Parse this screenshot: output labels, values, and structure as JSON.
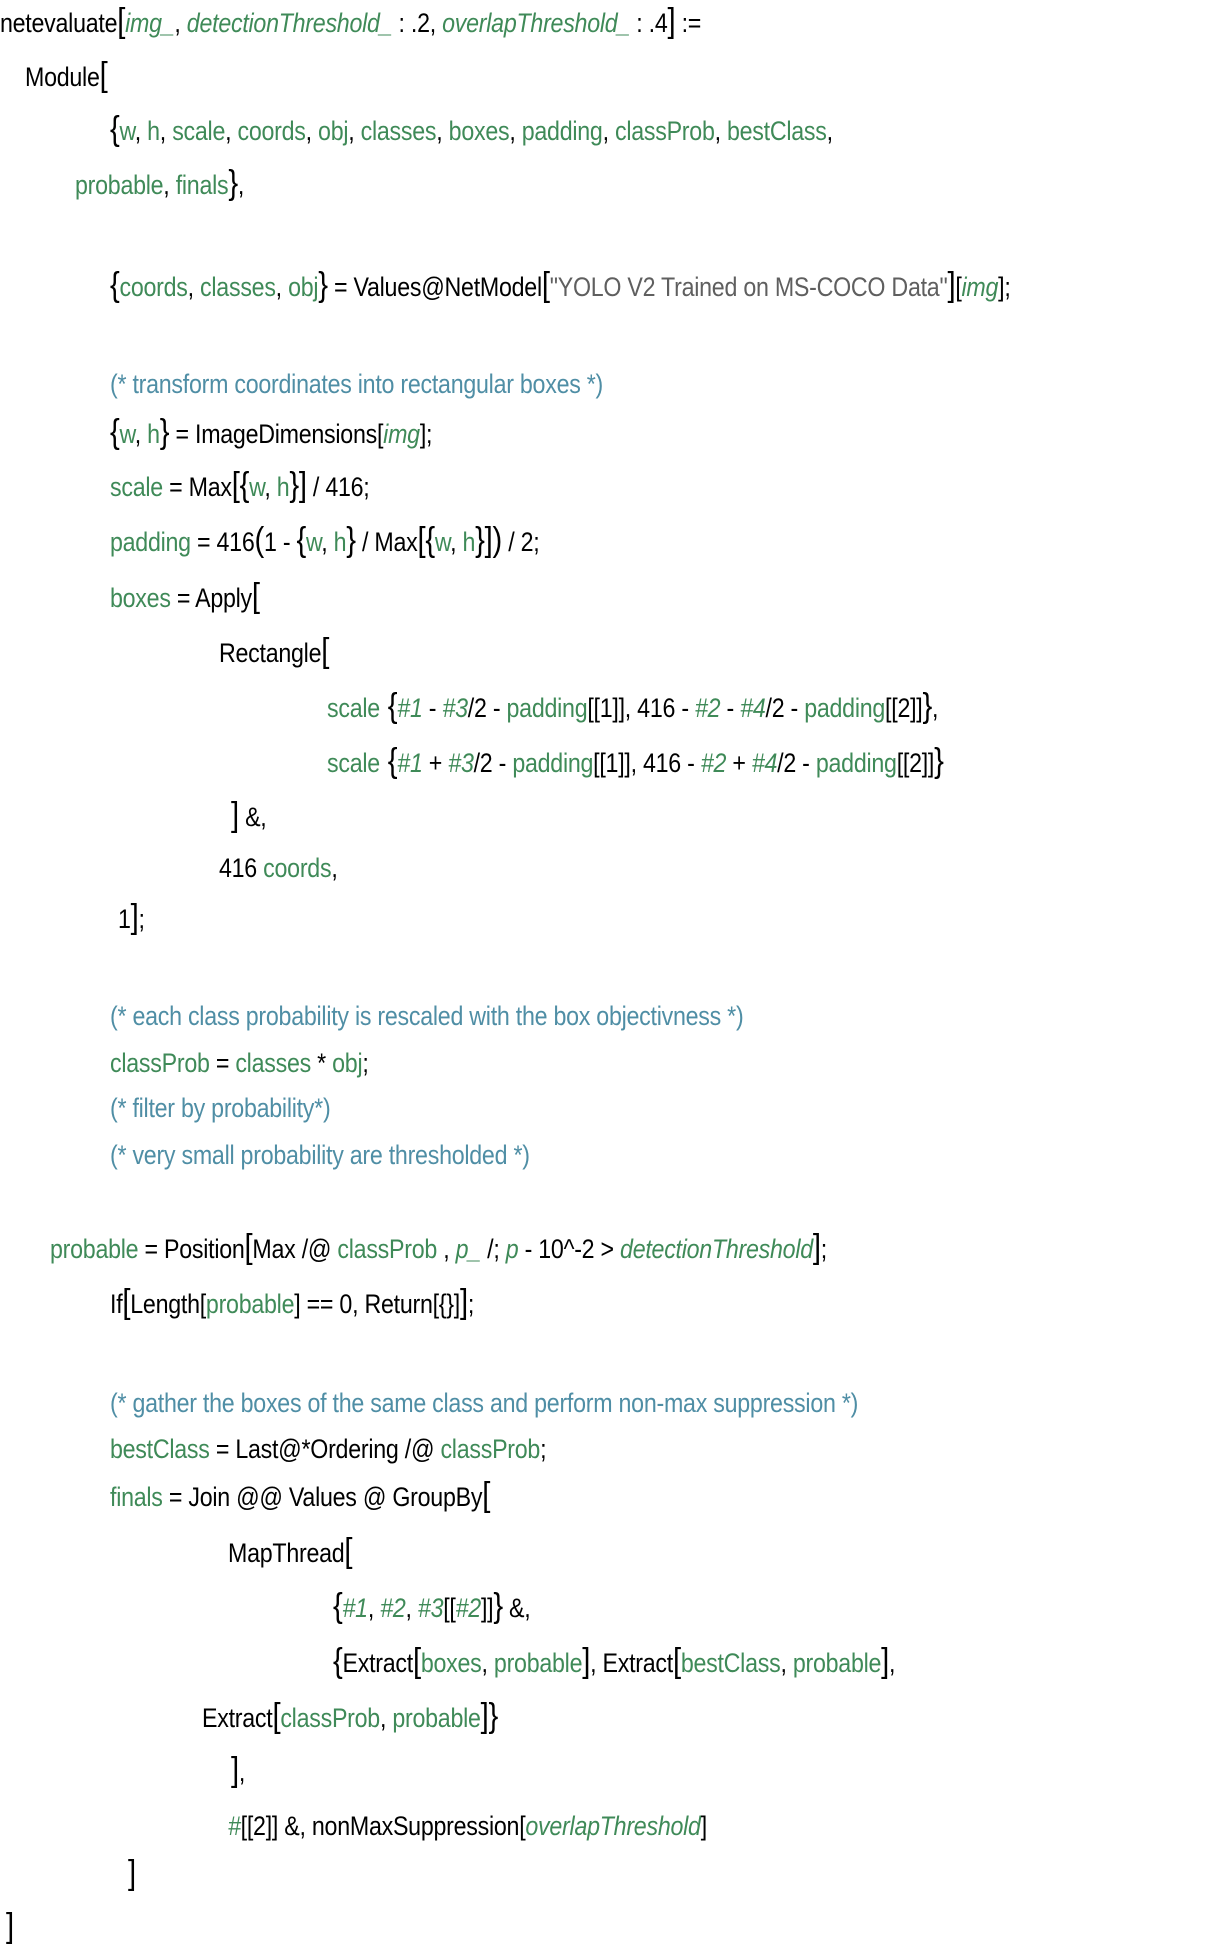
{
  "notebook": {
    "language": "Wolfram Language",
    "colors": {
      "keyword": "#000000",
      "local_variable": "#3f8a58",
      "string": "#5f5f5f",
      "comment": "#4f8ea5",
      "background": "#ffffff"
    },
    "lines": [
      {
        "tokens": [
          {
            "t": "netevaluate",
            "k": "k"
          },
          {
            "t": "[",
            "k": "k big"
          },
          {
            "t": "img_",
            "k": "vi"
          },
          {
            "t": ", ",
            "k": "k"
          },
          {
            "t": "detectionThreshold_",
            "k": "vi"
          },
          {
            "t": " : .2, ",
            "k": "k"
          },
          {
            "t": "overlapThreshold_",
            "k": "vi"
          },
          {
            "t": " : .4",
            "k": "k"
          },
          {
            "t": "]",
            "k": "k big"
          },
          {
            "t": " :=",
            "k": "k"
          }
        ]
      },
      {
        "tokens": [
          {
            "t": "Module",
            "k": "k"
          },
          {
            "t": "[",
            "k": "k big"
          }
        ]
      },
      {
        "tokens": [
          {
            "t": "{",
            "k": "k big"
          },
          {
            "t": "w",
            "k": "v"
          },
          {
            "t": ", ",
            "k": "k"
          },
          {
            "t": "h",
            "k": "v"
          },
          {
            "t": ", ",
            "k": "k"
          },
          {
            "t": "scale",
            "k": "v"
          },
          {
            "t": ", ",
            "k": "k"
          },
          {
            "t": "coords",
            "k": "v"
          },
          {
            "t": ", ",
            "k": "k"
          },
          {
            "t": "obj",
            "k": "v"
          },
          {
            "t": ", ",
            "k": "k"
          },
          {
            "t": "classes",
            "k": "v"
          },
          {
            "t": ", ",
            "k": "k"
          },
          {
            "t": "boxes",
            "k": "v"
          },
          {
            "t": ", ",
            "k": "k"
          },
          {
            "t": "padding",
            "k": "v"
          },
          {
            "t": ", ",
            "k": "k"
          },
          {
            "t": "classProb",
            "k": "v"
          },
          {
            "t": ", ",
            "k": "k"
          },
          {
            "t": "bestClass",
            "k": "v"
          },
          {
            "t": ",",
            "k": "k"
          }
        ]
      },
      {
        "tokens": [
          {
            "t": "probable",
            "k": "v"
          },
          {
            "t": ", ",
            "k": "k"
          },
          {
            "t": "finals",
            "k": "v"
          },
          {
            "t": "}",
            "k": "k big"
          },
          {
            "t": ",",
            "k": "k"
          }
        ]
      },
      {
        "tokens": [
          {
            "t": "{",
            "k": "k big"
          },
          {
            "t": "coords",
            "k": "v"
          },
          {
            "t": ", ",
            "k": "k"
          },
          {
            "t": "classes",
            "k": "v"
          },
          {
            "t": ", ",
            "k": "k"
          },
          {
            "t": "obj",
            "k": "v"
          },
          {
            "t": "}",
            "k": "k big"
          },
          {
            "t": " = Values@NetModel",
            "k": "k"
          },
          {
            "t": "[",
            "k": "k big"
          },
          {
            "t": "\"YOLO V2 Trained on MS-COCO Data\"",
            "k": "s"
          },
          {
            "t": "]",
            "k": "k big"
          },
          {
            "t": "[",
            "k": "k"
          },
          {
            "t": "img",
            "k": "vi"
          },
          {
            "t": "];",
            "k": "k"
          }
        ]
      },
      {
        "tokens": [
          {
            "t": "(* transform coordinates into rectangular boxes *)",
            "k": "c"
          }
        ]
      },
      {
        "tokens": [
          {
            "t": "{",
            "k": "k big"
          },
          {
            "t": "w",
            "k": "v"
          },
          {
            "t": ", ",
            "k": "k"
          },
          {
            "t": "h",
            "k": "v"
          },
          {
            "t": "}",
            "k": "k big"
          },
          {
            "t": " = ImageDimensions[",
            "k": "k"
          },
          {
            "t": "img",
            "k": "vi"
          },
          {
            "t": "];",
            "k": "k"
          }
        ]
      },
      {
        "tokens": [
          {
            "t": "scale",
            "k": "v"
          },
          {
            "t": " = Max",
            "k": "k"
          },
          {
            "t": "[{",
            "k": "k big"
          },
          {
            "t": "w",
            "k": "v"
          },
          {
            "t": ", ",
            "k": "k"
          },
          {
            "t": "h",
            "k": "v"
          },
          {
            "t": "}]",
            "k": "k big"
          },
          {
            "t": " / 416;",
            "k": "k"
          }
        ]
      },
      {
        "tokens": [
          {
            "t": "padding",
            "k": "v"
          },
          {
            "t": " = 416",
            "k": "k"
          },
          {
            "t": "(",
            "k": "k big"
          },
          {
            "t": "1 - ",
            "k": "k"
          },
          {
            "t": "{",
            "k": "k big"
          },
          {
            "t": "w",
            "k": "v"
          },
          {
            "t": ", ",
            "k": "k"
          },
          {
            "t": "h",
            "k": "v"
          },
          {
            "t": "}",
            "k": "k big"
          },
          {
            "t": " / Max",
            "k": "k"
          },
          {
            "t": "[{",
            "k": "k big"
          },
          {
            "t": "w",
            "k": "v"
          },
          {
            "t": ", ",
            "k": "k"
          },
          {
            "t": "h",
            "k": "v"
          },
          {
            "t": "}])",
            "k": "k big"
          },
          {
            "t": " / 2;",
            "k": "k"
          }
        ]
      },
      {
        "tokens": [
          {
            "t": "boxes",
            "k": "v"
          },
          {
            "t": " = Apply",
            "k": "k"
          },
          {
            "t": "[",
            "k": "k big"
          }
        ]
      },
      {
        "tokens": [
          {
            "t": "Rectangle",
            "k": "k"
          },
          {
            "t": "[",
            "k": "k big"
          }
        ]
      },
      {
        "tokens": [
          {
            "t": "scale",
            "k": "v"
          },
          {
            "t": " {",
            "k": "k big"
          },
          {
            "t": "#1",
            "k": "vi"
          },
          {
            "t": " - ",
            "k": "k"
          },
          {
            "t": "#3",
            "k": "vi"
          },
          {
            "t": "/2 - ",
            "k": "k"
          },
          {
            "t": "padding",
            "k": "v"
          },
          {
            "t": "[[1]], 416 - ",
            "k": "k"
          },
          {
            "t": "#2",
            "k": "vi"
          },
          {
            "t": " - ",
            "k": "k"
          },
          {
            "t": "#4",
            "k": "vi"
          },
          {
            "t": "/2 - ",
            "k": "k"
          },
          {
            "t": "padding",
            "k": "v"
          },
          {
            "t": "[[2]]",
            "k": "k"
          },
          {
            "t": "}",
            "k": "k big"
          },
          {
            "t": ",",
            "k": "k"
          }
        ]
      },
      {
        "tokens": [
          {
            "t": "scale",
            "k": "v"
          },
          {
            "t": " {",
            "k": "k big"
          },
          {
            "t": "#1",
            "k": "vi"
          },
          {
            "t": " + ",
            "k": "k"
          },
          {
            "t": "#3",
            "k": "vi"
          },
          {
            "t": "/2 - ",
            "k": "k"
          },
          {
            "t": "padding",
            "k": "v"
          },
          {
            "t": "[[1]], 416 - ",
            "k": "k"
          },
          {
            "t": "#2",
            "k": "vi"
          },
          {
            "t": " + ",
            "k": "k"
          },
          {
            "t": "#4",
            "k": "vi"
          },
          {
            "t": "/2 - ",
            "k": "k"
          },
          {
            "t": "padding",
            "k": "v"
          },
          {
            "t": "[[2]]",
            "k": "k"
          },
          {
            "t": "}",
            "k": "k big"
          }
        ]
      },
      {
        "tokens": [
          {
            "t": "]",
            "k": "k big"
          },
          {
            "t": " &,",
            "k": "k"
          }
        ]
      },
      {
        "tokens": [
          {
            "t": "416 ",
            "k": "k"
          },
          {
            "t": "coords",
            "k": "v"
          },
          {
            "t": ",",
            "k": "k"
          }
        ]
      },
      {
        "tokens": [
          {
            "t": "1",
            "k": "k"
          },
          {
            "t": "]",
            "k": "k big"
          },
          {
            "t": ";",
            "k": "k"
          }
        ]
      },
      {
        "tokens": [
          {
            "t": "(* each class probability is rescaled with the box objectivness *)",
            "k": "c"
          }
        ]
      },
      {
        "tokens": [
          {
            "t": "classProb",
            "k": "v"
          },
          {
            "t": " = ",
            "k": "k"
          },
          {
            "t": "classes",
            "k": "v"
          },
          {
            "t": " * ",
            "k": "k"
          },
          {
            "t": "obj",
            "k": "v"
          },
          {
            "t": ";",
            "k": "k"
          }
        ]
      },
      {
        "tokens": [
          {
            "t": "(* filter by probability*)",
            "k": "c"
          }
        ]
      },
      {
        "tokens": [
          {
            "t": "(* very small probability are thresholded *)",
            "k": "c"
          }
        ]
      },
      {
        "tokens": [
          {
            "t": "probable",
            "k": "v"
          },
          {
            "t": " = Position",
            "k": "k"
          },
          {
            "t": "[",
            "k": "k big"
          },
          {
            "t": "Max /@ ",
            "k": "k"
          },
          {
            "t": "classProb",
            "k": "v"
          },
          {
            "t": " , ",
            "k": "k"
          },
          {
            "t": "p_",
            "k": "vi"
          },
          {
            "t": " /; ",
            "k": "k"
          },
          {
            "t": "p",
            "k": "vi"
          },
          {
            "t": " - 10^-2 > ",
            "k": "k"
          },
          {
            "t": "detectionThreshold",
            "k": "vi"
          },
          {
            "t": "]",
            "k": "k big"
          },
          {
            "t": ";",
            "k": "k"
          }
        ]
      },
      {
        "tokens": [
          {
            "t": "If",
            "k": "k"
          },
          {
            "t": "[",
            "k": "k big"
          },
          {
            "t": "Length[",
            "k": "k"
          },
          {
            "t": "probable",
            "k": "v"
          },
          {
            "t": "] == 0, Return[{}]",
            "k": "k"
          },
          {
            "t": "]",
            "k": "k big"
          },
          {
            "t": ";",
            "k": "k"
          }
        ]
      },
      {
        "tokens": [
          {
            "t": "(* gather the boxes of the same class and perform non-max suppression *)",
            "k": "c"
          }
        ]
      },
      {
        "tokens": [
          {
            "t": "bestClass",
            "k": "v"
          },
          {
            "t": " = Last@*Ordering /@ ",
            "k": "k"
          },
          {
            "t": "classProb",
            "k": "v"
          },
          {
            "t": ";",
            "k": "k"
          }
        ]
      },
      {
        "tokens": [
          {
            "t": "finals",
            "k": "v"
          },
          {
            "t": " = Join @@ Values @ GroupBy",
            "k": "k"
          },
          {
            "t": "[",
            "k": "k big"
          }
        ]
      },
      {
        "tokens": [
          {
            "t": "MapThread",
            "k": "k"
          },
          {
            "t": "[",
            "k": "k big"
          }
        ]
      },
      {
        "tokens": [
          {
            "t": "{",
            "k": "k big"
          },
          {
            "t": "#1",
            "k": "vi"
          },
          {
            "t": ", ",
            "k": "k"
          },
          {
            "t": "#2",
            "k": "vi"
          },
          {
            "t": ", ",
            "k": "k"
          },
          {
            "t": "#3",
            "k": "vi"
          },
          {
            "t": "[[",
            "k": "k"
          },
          {
            "t": "#2",
            "k": "vi"
          },
          {
            "t": "]]",
            "k": "k"
          },
          {
            "t": "}",
            "k": "k big"
          },
          {
            "t": " &,",
            "k": "k"
          }
        ]
      },
      {
        "tokens": [
          {
            "t": "{",
            "k": "k big"
          },
          {
            "t": "Extract",
            "k": "k"
          },
          {
            "t": "[",
            "k": "k big"
          },
          {
            "t": "boxes",
            "k": "v"
          },
          {
            "t": ", ",
            "k": "k"
          },
          {
            "t": "probable",
            "k": "v"
          },
          {
            "t": "]",
            "k": "k big"
          },
          {
            "t": ", Extract",
            "k": "k"
          },
          {
            "t": "[",
            "k": "k big"
          },
          {
            "t": "bestClass",
            "k": "v"
          },
          {
            "t": ", ",
            "k": "k"
          },
          {
            "t": "probable",
            "k": "v"
          },
          {
            "t": "]",
            "k": "k big"
          },
          {
            "t": ",",
            "k": "k"
          }
        ]
      },
      {
        "tokens": [
          {
            "t": "Extract",
            "k": "k"
          },
          {
            "t": "[",
            "k": "k big"
          },
          {
            "t": "classProb",
            "k": "v"
          },
          {
            "t": ", ",
            "k": "k"
          },
          {
            "t": "probable",
            "k": "v"
          },
          {
            "t": "]}",
            "k": "k big"
          }
        ]
      },
      {
        "tokens": [
          {
            "t": "]",
            "k": "k big"
          },
          {
            "t": ",",
            "k": "k"
          }
        ]
      },
      {
        "tokens": [
          {
            "t": "#",
            "k": "vi"
          },
          {
            "t": "[[2]] &, nonMaxSuppression[",
            "k": "k"
          },
          {
            "t": "overlapThreshold",
            "k": "vi"
          },
          {
            "t": "]",
            "k": "k"
          }
        ]
      },
      {
        "tokens": [
          {
            "t": "]",
            "k": "k big"
          }
        ]
      },
      {
        "tokens": [
          {
            "t": "]",
            "k": "k big"
          }
        ]
      }
    ]
  }
}
